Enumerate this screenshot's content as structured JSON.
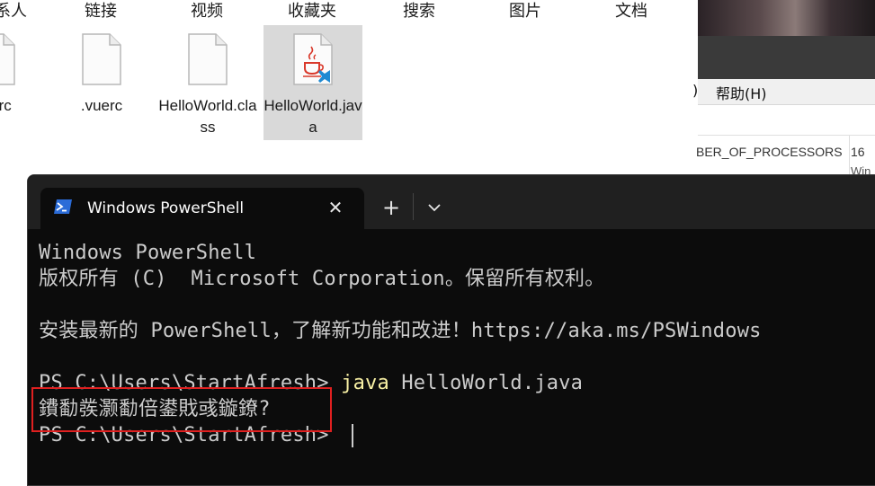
{
  "explorer": {
    "quick_access": [
      {
        "label": "系人"
      },
      {
        "label": "链接"
      },
      {
        "label": "视频"
      },
      {
        "label": "收藏夹"
      },
      {
        "label": "搜索"
      },
      {
        "label": "图片"
      },
      {
        "label": "文档"
      }
    ],
    "files": [
      {
        "name": "nrc",
        "icon": "file-icon"
      },
      {
        "name": ".vuerc",
        "icon": "file-icon"
      },
      {
        "name": "HelloWorld.class",
        "icon": "file-icon"
      },
      {
        "name": "HelloWorld.java",
        "icon": "java-file-icon",
        "selected": true
      }
    ]
  },
  "background_window": {
    "menu_paren": ")",
    "menu_help": "帮助(H)",
    "env_name": "BER_OF_PROCESSORS",
    "env_value": "16",
    "env_value2": "Win"
  },
  "terminal": {
    "tab_title": "Windows PowerShell",
    "close_glyph": "✕",
    "new_tab_glyph": "+",
    "lines": {
      "l1": "Windows PowerShell",
      "l2": "版权所有 (C)  Microsoft Corporation。保留所有权利。",
      "l3": "",
      "l4": "安装最新的 PowerShell，了解新功能和改进！https://aka.ms/PSWindows",
      "l5": "",
      "prompt1": "PS C:\\Users\\StartAfresh> ",
      "cmd_java": "java",
      "cmd_args": " HelloWorld.java",
      "output_garbled": "鐨勫彂灏勫倍鍙戝彧鏇鐐?",
      "prompt2": "PS C:\\Users\\StartAfresh> "
    },
    "colors": {
      "background": "#0c0c0c",
      "text": "#cccccc",
      "command": "#f9f1a5",
      "highlight": "#e02020"
    }
  }
}
